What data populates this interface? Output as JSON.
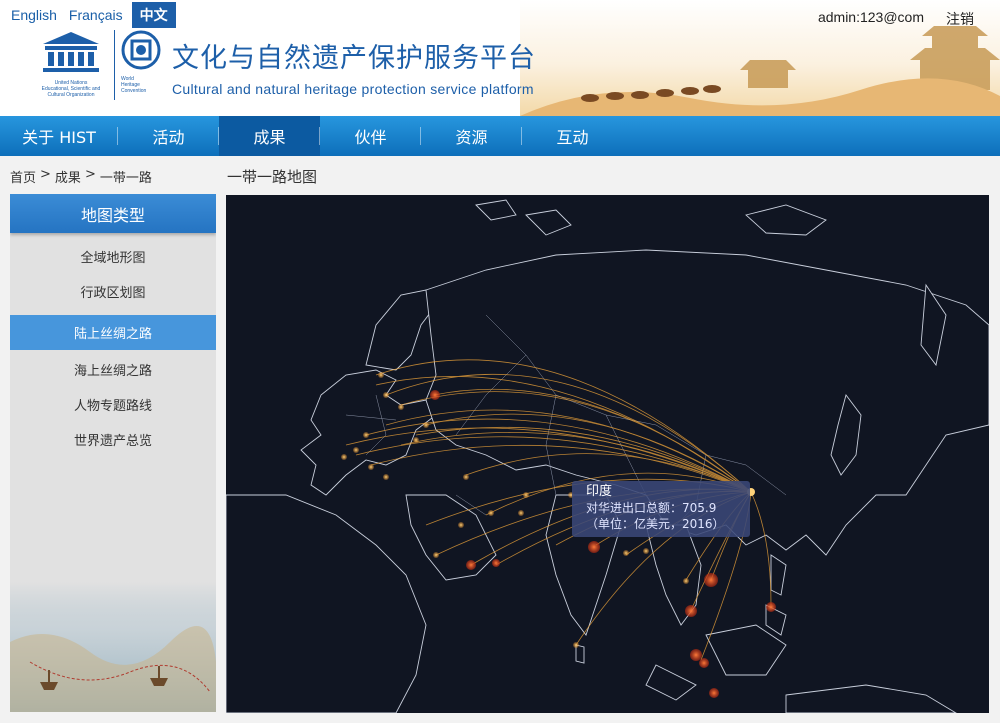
{
  "header": {
    "languages": [
      "English",
      "Français",
      "中文"
    ],
    "user": "admin:123@com",
    "logout": "注销",
    "title_cn": "文化与自然遗产保护服务平台",
    "title_en": "Cultural and natural heritage protection service platform",
    "unesco_caption": [
      "United Nations",
      "Educational, Scientific and",
      "Cultural Organization"
    ],
    "whc_caption": [
      "World",
      "Heritage",
      "Convention"
    ]
  },
  "nav": [
    "关于 HIST",
    "活动",
    "成果",
    "伙伴",
    "资源",
    "互动"
  ],
  "breadcrumb": [
    "首页",
    "成果",
    "一带一路"
  ],
  "breadcrumb_sep": ">",
  "page_title": "一带一路地图",
  "sidebar": {
    "title": "地图类型",
    "items": [
      "全域地形图",
      "行政区划图",
      "陆上丝绸之路",
      "海上丝绸之路",
      "人物专题路线",
      "世界遗产总览"
    ]
  },
  "tooltip": {
    "country": "印度",
    "line1": "对华进出口总额：705.9",
    "line2": "（单位：亿美元，2016）"
  },
  "colors": {
    "nav_bg": "#1a82cf",
    "nav_active": "#0c5aa1",
    "brand_blue": "#1d5fa9",
    "sidebar_active": "#4796dc",
    "map_bg": "#101522",
    "route_line": "#f0a63a",
    "highlight_dot": "#e04a1f"
  }
}
